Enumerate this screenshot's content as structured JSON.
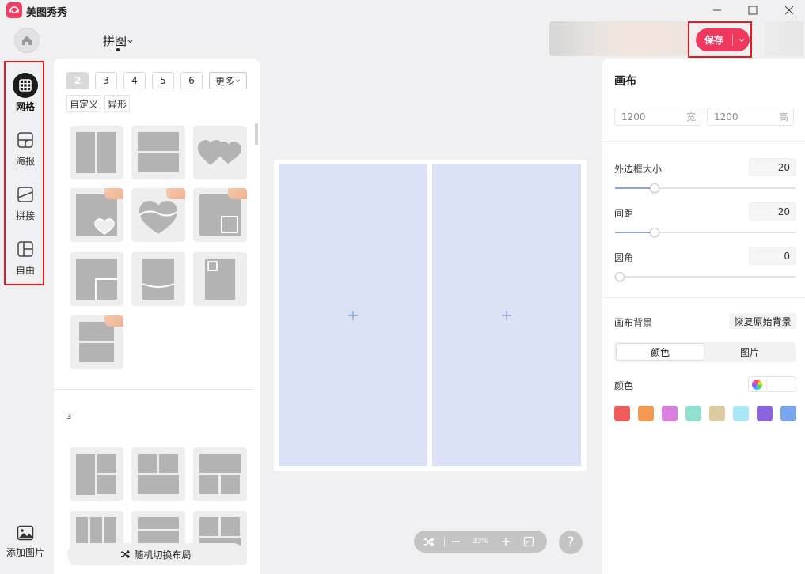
{
  "window": {
    "title": "美图秀秀",
    "brand_color": "#ee3f63",
    "controls": [
      "minimize-icon",
      "maximize-icon",
      "close-icon"
    ]
  },
  "header": {
    "mode_title": "拼图",
    "save_label": "保存",
    "save_color": "#f0385e"
  },
  "left_rail": {
    "items": [
      {
        "label": "网格",
        "icon": "grid-icon",
        "active": true
      },
      {
        "label": "海报",
        "icon": "poster-icon",
        "active": false
      },
      {
        "label": "拼接",
        "icon": "stitch-icon",
        "active": false
      },
      {
        "label": "自由",
        "icon": "freeform-icon",
        "active": false
      }
    ],
    "add_image_label": "添加图片"
  },
  "template_panel": {
    "counts": [
      "2",
      "3",
      "4",
      "5",
      "6"
    ],
    "selected_count": "2",
    "more_label": "更多",
    "shape_filters": [
      "自定义",
      "异形"
    ],
    "section_label": "3",
    "random_layout_label": "随机切换布局"
  },
  "canvas": {
    "cell_color": "#dbe2f6",
    "cell_count": 2
  },
  "zoom": {
    "level": "33%"
  },
  "right_panel": {
    "heading": "画布",
    "width_value": "1200",
    "width_unit": "宽",
    "height_value": "1200",
    "height_unit": "高",
    "border_label": "外边框大小",
    "border_value": "20",
    "spacing_label": "间距",
    "spacing_value": "20",
    "corner_label": "圆角",
    "corner_value": "0",
    "background_label": "画布背景",
    "restore_label": "恢复原始背景",
    "bg_tabs": [
      "颜色",
      "图片"
    ],
    "active_bg_tab": "颜色",
    "color_label": "颜色",
    "swatches": [
      "#ef5a5a",
      "#f39a50",
      "#d97fe0",
      "#8fe0d2",
      "#dccaa1",
      "#a8e8f5",
      "#8a64dd",
      "#7aa6f0"
    ]
  }
}
